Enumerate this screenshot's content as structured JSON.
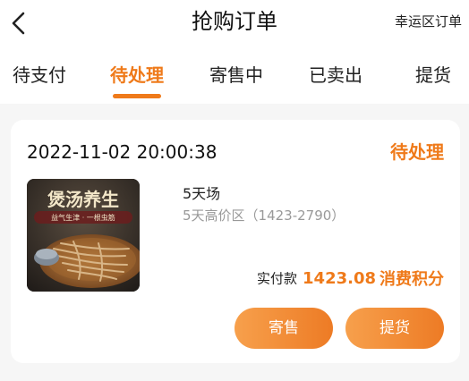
{
  "header": {
    "title": "抢购订单",
    "right_link": "幸运区订单",
    "back_icon": "chevron-left-icon"
  },
  "tabs": [
    {
      "label": "待支付",
      "active": false
    },
    {
      "label": "待处理",
      "active": true
    },
    {
      "label": "寄售中",
      "active": false
    },
    {
      "label": "已卖出",
      "active": false
    },
    {
      "label": "提货",
      "active": false
    }
  ],
  "order": {
    "time": "2022-11-02 20:00:38",
    "status": "待处理",
    "product": {
      "name": "5天场",
      "subtitle": "5天高价区（1423-2790）",
      "image": {
        "headline": "煲汤养生",
        "tagline": "益气生津 · 一根虫筋"
      }
    },
    "pay_label": "实付款",
    "pay_amount": "1423.08",
    "pay_unit": "消费积分"
  },
  "actions": {
    "consign": "寄售",
    "pickup": "提货"
  },
  "colors": {
    "accent": "#ef7a1a",
    "button_gradient_start": "#f7a04c",
    "button_gradient_end": "#ed7b25",
    "muted_text": "#999999",
    "page_background": "#f6f6f6"
  }
}
